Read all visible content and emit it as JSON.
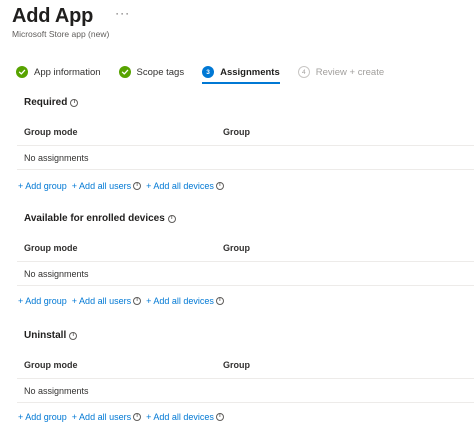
{
  "header": {
    "title": "Add App",
    "more": "···",
    "subtitle": "Microsoft Store app (new)"
  },
  "steps": [
    {
      "label": "App information",
      "state": "done"
    },
    {
      "label": "Scope tags",
      "state": "done"
    },
    {
      "label": "Assignments",
      "state": "current",
      "number": "3"
    },
    {
      "label": "Review + create",
      "state": "future",
      "number": "4"
    }
  ],
  "colors": {
    "accent": "#0078d4",
    "success": "#57a300",
    "disabled": "#a19f9d"
  },
  "sections": [
    {
      "title": "Required",
      "columns": [
        "Group mode",
        "Group"
      ],
      "empty_text": "No assignments",
      "actions": [
        "+ Add group",
        "+ Add all users",
        "+ Add all devices"
      ]
    },
    {
      "title": "Available for enrolled devices",
      "columns": [
        "Group mode",
        "Group"
      ],
      "empty_text": "No assignments",
      "actions": [
        "+ Add group",
        "+ Add all users",
        "+ Add all devices"
      ]
    },
    {
      "title": "Uninstall",
      "columns": [
        "Group mode",
        "Group"
      ],
      "empty_text": "No assignments",
      "actions": [
        "+ Add group",
        "+ Add all users",
        "+ Add all devices"
      ]
    }
  ]
}
